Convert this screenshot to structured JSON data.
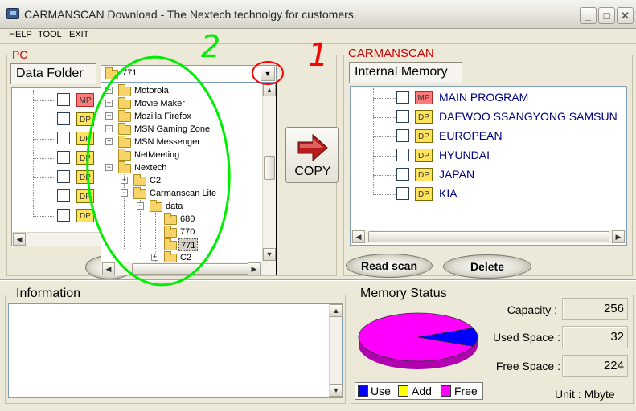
{
  "window": {
    "title": "CARMANSCAN Download -  The Nextech technolgy for customers.",
    "controls": {
      "minimize": "_",
      "maximize": "□",
      "close": "✕"
    }
  },
  "menu": {
    "help": "HELP",
    "tool": "TOOL",
    "exit": "EXIT"
  },
  "pc": {
    "group_label": "PC",
    "tab": "Data Folder",
    "selected_folder": "771",
    "visible_icon_labels": [
      "MP",
      "DP",
      "DP",
      "DP",
      "DP",
      "DP",
      "DP"
    ]
  },
  "folder_tree": [
    {
      "label": "Motorola",
      "expander": "+"
    },
    {
      "label": "Movie Maker",
      "expander": "+"
    },
    {
      "label": "Mozilla Firefox",
      "expander": "+"
    },
    {
      "label": "MSN Gaming Zone",
      "expander": "+"
    },
    {
      "label": "MSN Messenger",
      "expander": "+"
    },
    {
      "label": "NetMeeting",
      "expander": ""
    },
    {
      "label": "Nextech",
      "expander": "−"
    },
    {
      "label": "C2",
      "expander": "+"
    },
    {
      "label": "Carmanscan Lite",
      "expander": "−"
    },
    {
      "label": "data",
      "expander": "−"
    },
    {
      "label": "680",
      "expander": ""
    },
    {
      "label": "770",
      "expander": ""
    },
    {
      "label": "771",
      "expander": "",
      "selected": true
    },
    {
      "label": "C2",
      "expander": "+"
    }
  ],
  "copy_button": {
    "label": "COPY"
  },
  "carmanscan": {
    "group_label": "CARMANSCAN",
    "tab": "Internal Memory",
    "items": [
      {
        "icon": "MP",
        "label": "MAIN PROGRAM"
      },
      {
        "icon": "DP",
        "label": "DAEWOO SSANGYONG SAMSUN"
      },
      {
        "icon": "DP",
        "label": "EUROPEAN"
      },
      {
        "icon": "DP",
        "label": "HYUNDAI"
      },
      {
        "icon": "DP",
        "label": "JAPAN"
      },
      {
        "icon": "DP",
        "label": "KIA"
      }
    ],
    "read_scan": "Read  scan",
    "delete": "Delete"
  },
  "information": {
    "title": "Information",
    "text": ""
  },
  "memory_status": {
    "title": "Memory Status",
    "capacity_label": "Capacity :",
    "capacity_value": "256",
    "used_label": "Used Space :",
    "used_value": "32",
    "free_label": "Free Space :",
    "free_value": "224",
    "unit": "Unit : Mbyte",
    "legend": {
      "use": "Use",
      "add": "Add",
      "free": "Free"
    },
    "colors": {
      "use": "#0000ff",
      "add": "#ffff00",
      "free": "#ff00ff"
    }
  },
  "annotations": {
    "one": "1",
    "two": "2",
    "color": "#ff0000",
    "circle_color": "#00ee00"
  }
}
